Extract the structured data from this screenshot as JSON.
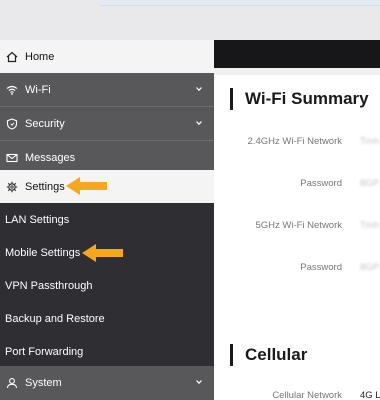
{
  "sidebar": {
    "items": [
      {
        "label": "Home",
        "icon": "home-icon"
      },
      {
        "label": "Wi-Fi",
        "icon": "wifi-icon"
      },
      {
        "label": "Security",
        "icon": "shield-icon"
      },
      {
        "label": "Messages",
        "icon": "envelope-icon"
      },
      {
        "label": "Settings",
        "icon": "gear-icon"
      },
      {
        "label": "LAN Settings"
      },
      {
        "label": "Mobile Settings"
      },
      {
        "label": "VPN Passthrough"
      },
      {
        "label": "Backup and Restore"
      },
      {
        "label": "Port Forwarding"
      },
      {
        "label": "System",
        "icon": "user-icon"
      }
    ]
  },
  "wifi_summary": {
    "title": "Wi-Fi Summary",
    "rows": [
      {
        "label": "2.4GHz Wi-Fi Network",
        "value": "Tmh"
      },
      {
        "label": "Password",
        "value": "8GP"
      },
      {
        "label": "5GHz Wi-Fi Network",
        "value": "Tmh"
      },
      {
        "label": "Password",
        "value": "8GP"
      }
    ]
  },
  "cellular": {
    "title": "Cellular",
    "rows": [
      {
        "label": "Cellular Network",
        "value": "4G L"
      }
    ]
  },
  "colors": {
    "highlight_arrow": "#f5a81c",
    "sidebar_dark": "#2f2f33",
    "sidebar_grey": "#58585b",
    "sidebar_active": "#f4f4f5"
  }
}
